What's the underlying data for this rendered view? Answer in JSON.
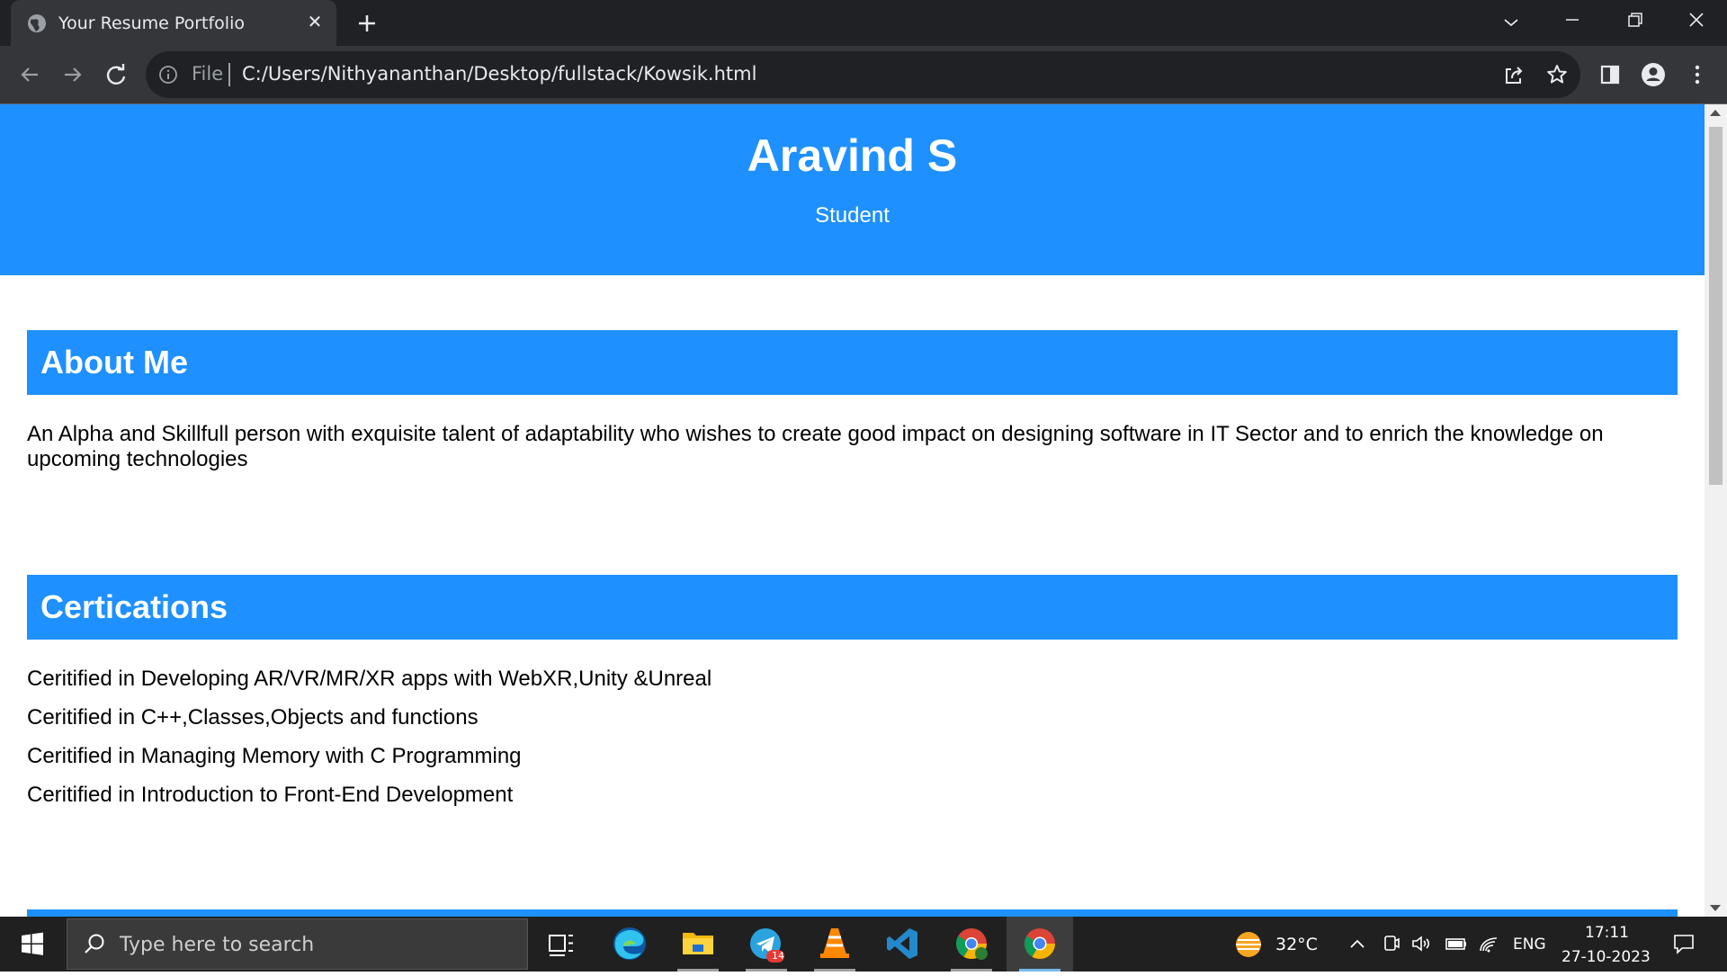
{
  "browser": {
    "tab_title": "Your Resume Portfolio",
    "url_scheme": "File",
    "url": "C:/Users/Nithyananthan/Desktop/fullstack/Kowsik.html"
  },
  "page": {
    "name": "Aravind S",
    "role": "Student",
    "about": {
      "heading": "About Me",
      "text": "An Alpha and Skillfull person with exquisite talent of adaptability who wishes to create good impact on designing software in IT Sector and to enrich the knowledge on upcoming technologies"
    },
    "certifications": {
      "heading": "Certications",
      "items": [
        "Ceritified in Developing AR/VR/MR/XR apps with WebXR,Unity &Unreal",
        "Ceritified in C++,Classes,Objects and functions",
        "Ceritified in Managing Memory with C Programming",
        "Ceritified in Introduction to Front-End Development"
      ]
    }
  },
  "taskbar": {
    "search_placeholder": "Type here to search",
    "telegram_badge": "14",
    "weather": "32°C",
    "language": "ENG",
    "time": "17:11",
    "date": "27-10-2023",
    "apps": [
      "task-view",
      "edge",
      "file-explorer",
      "telegram",
      "vlc",
      "vscode",
      "chrome-profile",
      "chrome"
    ]
  },
  "colors": {
    "accent": "#1e90ff",
    "chrome_dark": "#202124",
    "chrome_toolbar": "#35363a"
  }
}
